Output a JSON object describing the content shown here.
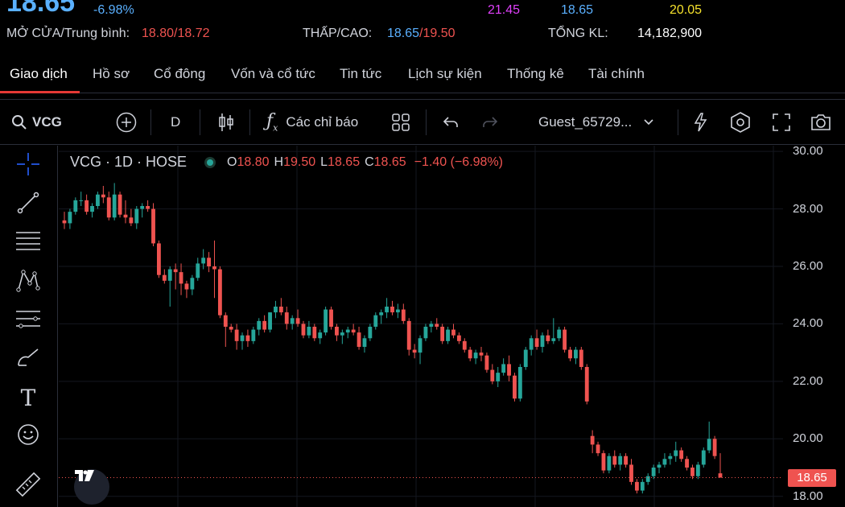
{
  "quote": {
    "price": "18.65",
    "change_pct": "-6.98%",
    "ceiling": "21.45",
    "reference": "18.65",
    "floor_or_ceiling_yellow": "20.05",
    "open_avg_label": "MỞ CỬA/Trung bình:",
    "open": "18.80",
    "avg": "18.72",
    "low_high_label": "THẤP/CAO:",
    "low": "18.65",
    "high": "19.50",
    "volume_label": "TỔNG KL:",
    "volume": "14,182,900"
  },
  "tabs": [
    {
      "label": "Giao dịch",
      "active": true
    },
    {
      "label": "Hồ sơ"
    },
    {
      "label": "Cổ đông"
    },
    {
      "label": "Vốn và cổ tức"
    },
    {
      "label": "Tin tức"
    },
    {
      "label": "Lịch sự kiện"
    },
    {
      "label": "Thống kê"
    },
    {
      "label": "Tài chính"
    }
  ],
  "toolbar": {
    "symbol": "VCG",
    "interval": "D",
    "indicators_label": "Các chỉ báo",
    "user": "Guest_65729..."
  },
  "legend": {
    "title": "VCG · 1D · HOSE",
    "o_key": "O",
    "o": "18.80",
    "h_key": "H",
    "h": "19.50",
    "l_key": "L",
    "l": "18.65",
    "c_key": "C",
    "c": "18.65",
    "change": "−1.40 (−6.98%)"
  },
  "colors": {
    "up": "#26a69a",
    "down": "#ef5350",
    "accent": "#5ab0ff"
  },
  "chart_data": {
    "type": "candlestick",
    "y_axis": {
      "ticks": [
        "30.00",
        "28.00",
        "26.00",
        "24.00",
        "22.00",
        "20.00",
        "18.00"
      ],
      "ylim": [
        17.6,
        30.2
      ]
    },
    "last_price_label": "18.65",
    "grid": true,
    "candles": [
      [
        27.6,
        27.9,
        27.3,
        27.5
      ],
      [
        27.5,
        28.0,
        27.3,
        27.9
      ],
      [
        27.9,
        28.4,
        27.8,
        28.3
      ],
      [
        28.3,
        28.6,
        28.1,
        28.3
      ],
      [
        28.3,
        28.5,
        27.8,
        27.9
      ],
      [
        27.9,
        28.2,
        27.7,
        28.1
      ],
      [
        28.1,
        28.6,
        28.0,
        28.5
      ],
      [
        28.5,
        28.8,
        28.2,
        28.4
      ],
      [
        28.4,
        28.6,
        27.6,
        27.7
      ],
      [
        27.7,
        28.9,
        27.6,
        28.5
      ],
      [
        28.5,
        28.6,
        27.7,
        27.8
      ],
      [
        27.8,
        28.3,
        27.5,
        27.7
      ],
      [
        27.7,
        28.0,
        27.4,
        27.5
      ],
      [
        27.5,
        28.1,
        27.3,
        28.0
      ],
      [
        28.0,
        28.2,
        27.7,
        28.1
      ],
      [
        28.1,
        28.3,
        27.9,
        28.0
      ],
      [
        28.0,
        28.2,
        26.7,
        26.8
      ],
      [
        26.8,
        26.9,
        25.6,
        25.7
      ],
      [
        25.7,
        25.9,
        25.4,
        25.5
      ],
      [
        25.5,
        26.0,
        24.6,
        25.9
      ],
      [
        25.9,
        26.1,
        25.2,
        25.8
      ],
      [
        25.8,
        26.1,
        25.0,
        25.4
      ],
      [
        25.4,
        25.5,
        24.9,
        25.2
      ],
      [
        25.2,
        25.7,
        25.0,
        25.6
      ],
      [
        25.6,
        26.3,
        25.5,
        26.1
      ],
      [
        26.1,
        26.6,
        25.9,
        26.3
      ],
      [
        26.3,
        26.5,
        25.8,
        26.0
      ],
      [
        26.0,
        26.9,
        24.9,
        25.9
      ],
      [
        25.9,
        26.0,
        24.2,
        24.3
      ],
      [
        24.3,
        24.4,
        23.2,
        23.9
      ],
      [
        23.9,
        24.0,
        23.7,
        23.8
      ],
      [
        23.8,
        24.0,
        23.1,
        23.4
      ],
      [
        23.4,
        23.7,
        23.1,
        23.6
      ],
      [
        23.6,
        23.8,
        23.2,
        23.4
      ],
      [
        23.4,
        23.9,
        23.3,
        23.8
      ],
      [
        23.8,
        24.2,
        23.6,
        24.1
      ],
      [
        24.1,
        24.3,
        23.7,
        23.8
      ],
      [
        23.8,
        24.4,
        23.7,
        24.4
      ],
      [
        24.4,
        24.8,
        24.2,
        24.6
      ],
      [
        24.6,
        24.9,
        24.3,
        24.4
      ],
      [
        24.4,
        24.6,
        23.8,
        24.0
      ],
      [
        24.0,
        24.3,
        23.8,
        24.2
      ],
      [
        24.2,
        24.5,
        23.9,
        24.0
      ],
      [
        24.0,
        24.1,
        23.5,
        23.6
      ],
      [
        23.6,
        24.1,
        23.5,
        23.9
      ],
      [
        23.9,
        24.0,
        23.4,
        23.5
      ],
      [
        23.5,
        23.8,
        23.3,
        23.7
      ],
      [
        23.7,
        24.6,
        23.6,
        24.5
      ],
      [
        24.5,
        24.6,
        23.8,
        23.9
      ],
      [
        23.9,
        24.0,
        23.4,
        23.6
      ],
      [
        23.6,
        23.8,
        23.3,
        23.7
      ],
      [
        23.7,
        23.9,
        23.5,
        23.8
      ],
      [
        23.8,
        24.0,
        23.6,
        23.7
      ],
      [
        23.7,
        23.9,
        23.1,
        23.2
      ],
      [
        23.2,
        23.6,
        23.0,
        23.5
      ],
      [
        23.5,
        24.0,
        23.4,
        23.9
      ],
      [
        23.9,
        24.4,
        23.8,
        24.3
      ],
      [
        24.3,
        24.5,
        24.0,
        24.4
      ],
      [
        24.4,
        24.9,
        24.2,
        24.6
      ],
      [
        24.6,
        24.8,
        24.3,
        24.4
      ],
      [
        24.4,
        24.7,
        24.2,
        24.5
      ],
      [
        24.5,
        24.7,
        24.0,
        24.1
      ],
      [
        24.1,
        24.2,
        22.9,
        23.1
      ],
      [
        23.1,
        23.3,
        22.8,
        23.0
      ],
      [
        23.0,
        23.6,
        22.6,
        23.5
      ],
      [
        23.5,
        24.0,
        23.4,
        23.9
      ],
      [
        23.9,
        24.1,
        23.7,
        24.0
      ],
      [
        24.0,
        24.2,
        23.8,
        23.9
      ],
      [
        23.9,
        24.0,
        23.3,
        23.4
      ],
      [
        23.4,
        23.9,
        23.3,
        23.8
      ],
      [
        23.8,
        24.0,
        23.5,
        23.6
      ],
      [
        23.6,
        23.7,
        23.3,
        23.4
      ],
      [
        23.4,
        23.5,
        23.0,
        23.1
      ],
      [
        23.1,
        23.2,
        22.7,
        22.8
      ],
      [
        22.8,
        23.1,
        22.6,
        23.0
      ],
      [
        23.0,
        23.2,
        22.7,
        22.9
      ],
      [
        22.9,
        23.0,
        22.3,
        22.4
      ],
      [
        22.4,
        22.6,
        21.9,
        22.0
      ],
      [
        22.0,
        22.5,
        21.8,
        22.3
      ],
      [
        22.3,
        22.8,
        22.2,
        22.6
      ],
      [
        22.6,
        22.9,
        22.0,
        22.2
      ],
      [
        22.2,
        22.3,
        21.3,
        21.4
      ],
      [
        21.4,
        22.6,
        21.3,
        22.5
      ],
      [
        22.5,
        23.2,
        22.4,
        23.1
      ],
      [
        23.1,
        23.6,
        22.9,
        23.5
      ],
      [
        23.5,
        23.8,
        23.1,
        23.2
      ],
      [
        23.2,
        23.7,
        23.0,
        23.6
      ],
      [
        23.6,
        23.8,
        23.3,
        23.4
      ],
      [
        23.4,
        24.2,
        23.3,
        23.5
      ],
      [
        23.5,
        23.9,
        23.4,
        23.8
      ],
      [
        23.8,
        23.9,
        23.0,
        23.1
      ],
      [
        23.1,
        23.2,
        22.7,
        22.8
      ],
      [
        22.8,
        23.2,
        22.6,
        23.1
      ],
      [
        23.1,
        23.2,
        22.4,
        22.5
      ],
      [
        22.5,
        22.6,
        21.2,
        21.3
      ],
      [
        20.1,
        20.3,
        19.5,
        19.8
      ],
      [
        19.8,
        19.9,
        19.4,
        19.5
      ],
      [
        19.5,
        19.6,
        18.8,
        18.9
      ],
      [
        18.9,
        19.5,
        18.8,
        19.4
      ],
      [
        19.4,
        19.6,
        19.0,
        19.1
      ],
      [
        19.1,
        19.5,
        18.9,
        19.4
      ],
      [
        19.4,
        19.5,
        19.0,
        19.1
      ],
      [
        19.1,
        19.3,
        18.4,
        18.5
      ],
      [
        18.5,
        18.6,
        18.1,
        18.2
      ],
      [
        18.2,
        18.6,
        18.1,
        18.5
      ],
      [
        18.5,
        18.8,
        18.4,
        18.7
      ],
      [
        18.7,
        19.1,
        18.6,
        19.0
      ],
      [
        19.0,
        19.2,
        18.8,
        19.1
      ],
      [
        19.1,
        19.5,
        19.0,
        19.3
      ],
      [
        19.3,
        19.5,
        19.1,
        19.4
      ],
      [
        19.4,
        19.9,
        19.2,
        19.6
      ],
      [
        19.6,
        19.7,
        19.2,
        19.3
      ],
      [
        19.3,
        19.4,
        18.9,
        19.0
      ],
      [
        19.0,
        19.1,
        18.6,
        18.7
      ],
      [
        18.7,
        19.2,
        18.6,
        19.1
      ],
      [
        19.1,
        19.7,
        19.0,
        19.6
      ],
      [
        19.6,
        20.6,
        19.5,
        20.0
      ],
      [
        20.0,
        20.1,
        19.3,
        19.4
      ],
      [
        18.8,
        19.5,
        18.65,
        18.65
      ]
    ]
  }
}
